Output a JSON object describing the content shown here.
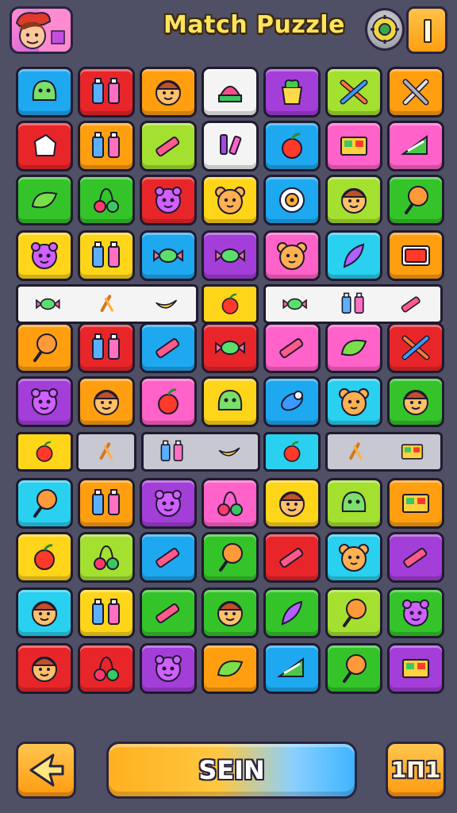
{
  "header": {
    "title": "Match Puzzle",
    "avatar_icon": "character-avatar-icon",
    "settings_icon": "gear-icon",
    "hint_icon": "hint-bar-icon"
  },
  "colors": {
    "background": "#4f4f66",
    "title": "#ffe45c",
    "orange": "#ff9f10",
    "red": "#e8262a",
    "blue": "#1ea8f0",
    "green": "#34c42a",
    "lime": "#a4e030",
    "yellow": "#ffd51a",
    "purple": "#a33ed8",
    "pink": "#ff62c8",
    "cyan": "#29d0f0",
    "white": "#f4f4f4"
  },
  "board": {
    "rows": [
      {
        "kind": "tiles",
        "tiles": [
          {
            "color": "blue",
            "icon": "slime-icon"
          },
          {
            "color": "red",
            "icon": "bottles-icon"
          },
          {
            "color": "orange",
            "icon": "face-icon"
          },
          {
            "color": "white",
            "icon": "cake-icon"
          },
          {
            "color": "purple",
            "icon": "potted-plant-icon"
          },
          {
            "color": "lime",
            "icon": "crossed-tools-icon"
          },
          {
            "color": "orange",
            "icon": "wrench-icon"
          }
        ]
      },
      {
        "kind": "tiles",
        "tiles": [
          {
            "color": "red",
            "icon": "sugar-cube-icon"
          },
          {
            "color": "orange",
            "icon": "bottle-pair-icon"
          },
          {
            "color": "lime",
            "icon": "crayon-icon"
          },
          {
            "color": "white",
            "icon": "markers-icon"
          },
          {
            "color": "blue",
            "icon": "cherry-icon"
          },
          {
            "color": "pink",
            "icon": "box-icon"
          },
          {
            "color": "pink",
            "icon": "candy-slice-icon"
          }
        ]
      },
      {
        "kind": "tiles",
        "tiles": [
          {
            "color": "green",
            "icon": "leaf-icon"
          },
          {
            "color": "green",
            "icon": "cherry-pair-icon"
          },
          {
            "color": "red",
            "icon": "monster-face-icon"
          },
          {
            "color": "yellow",
            "icon": "bear-face-icon"
          },
          {
            "color": "blue",
            "icon": "compass-icon"
          },
          {
            "color": "lime",
            "icon": "face-icon"
          },
          {
            "color": "green",
            "icon": "lollipop-icon"
          }
        ]
      },
      {
        "kind": "tiles",
        "tiles": [
          {
            "color": "yellow",
            "icon": "monster-face-icon"
          },
          {
            "color": "yellow",
            "icon": "bottle-pair-icon"
          },
          {
            "color": "blue",
            "icon": "candy-wrap-icon"
          },
          {
            "color": "purple",
            "icon": "candy-wrap-icon"
          },
          {
            "color": "pink",
            "icon": "bear-face-icon"
          },
          {
            "color": "cyan",
            "icon": "feather-icon"
          },
          {
            "color": "orange",
            "icon": "tv-icon"
          }
        ]
      },
      {
        "kind": "strip",
        "segments": [
          {
            "color": "white",
            "icons": [
              "candy-wrap-icon",
              "pretzel-icon",
              "banana-icon"
            ]
          },
          {
            "color": "yellow",
            "icons": [
              "berry-icon"
            ]
          },
          {
            "color": "white",
            "icons": [
              "candy-wrap-icon",
              "bottle-pair-icon",
              "crayon-icon"
            ]
          }
        ]
      },
      {
        "kind": "tiles",
        "tiles": [
          {
            "color": "orange",
            "icon": "lollipop-icon"
          },
          {
            "color": "red",
            "icon": "bottle-pair-icon"
          },
          {
            "color": "blue",
            "icon": "crayon-icon"
          },
          {
            "color": "red",
            "icon": "candy-wrap-icon"
          },
          {
            "color": "pink",
            "icon": "crayon-icon"
          },
          {
            "color": "pink",
            "icon": "leaf-icon"
          },
          {
            "color": "red",
            "icon": "crossed-tools-icon"
          }
        ]
      },
      {
        "kind": "tiles",
        "tiles": [
          {
            "color": "purple",
            "icon": "monster-face-icon"
          },
          {
            "color": "orange",
            "icon": "face-icon"
          },
          {
            "color": "pink",
            "icon": "berry-icon"
          },
          {
            "color": "yellow",
            "icon": "slime-icon"
          },
          {
            "color": "blue",
            "icon": "pacifier-icon"
          },
          {
            "color": "cyan",
            "icon": "bear-face-icon"
          },
          {
            "color": "green",
            "icon": "face-icon"
          }
        ]
      },
      {
        "kind": "strip",
        "segments": [
          {
            "color": "yellow",
            "icons": [
              "berry-icon"
            ]
          },
          {
            "color": "gray",
            "icons": [
              "pretzel-icon"
            ]
          },
          {
            "color": "gray",
            "icons": [
              "bottle-pair-icon",
              "banana-icon"
            ]
          },
          {
            "color": "cyan",
            "icons": [
              "cherry-icon"
            ]
          },
          {
            "color": "gray",
            "icons": [
              "pretzel-icon",
              "box-icon"
            ]
          }
        ]
      },
      {
        "kind": "tiles",
        "tiles": [
          {
            "color": "cyan",
            "icon": "lollipop-icon"
          },
          {
            "color": "orange",
            "icon": "bottle-pair-icon"
          },
          {
            "color": "purple",
            "icon": "monster-face-icon"
          },
          {
            "color": "pink",
            "icon": "cherry-pair-icon"
          },
          {
            "color": "yellow",
            "icon": "face-icon"
          },
          {
            "color": "lime",
            "icon": "slime-icon"
          },
          {
            "color": "orange",
            "icon": "box-icon"
          }
        ]
      },
      {
        "kind": "tiles",
        "tiles": [
          {
            "color": "yellow",
            "icon": "berry-icon"
          },
          {
            "color": "lime",
            "icon": "cherry-pair-icon"
          },
          {
            "color": "blue",
            "icon": "crayon-icon"
          },
          {
            "color": "green",
            "icon": "lollipop-icon"
          },
          {
            "color": "red",
            "icon": "crayon-icon"
          },
          {
            "color": "cyan",
            "icon": "bear-face-icon"
          },
          {
            "color": "purple",
            "icon": "crayon-icon"
          }
        ]
      },
      {
        "kind": "tiles",
        "tiles": [
          {
            "color": "cyan",
            "icon": "face-icon"
          },
          {
            "color": "yellow",
            "icon": "bottle-pair-icon"
          },
          {
            "color": "green",
            "icon": "crayon-icon"
          },
          {
            "color": "green",
            "icon": "face-icon"
          },
          {
            "color": "green",
            "icon": "feather-icon"
          },
          {
            "color": "lime",
            "icon": "lollipop-icon"
          },
          {
            "color": "green",
            "icon": "monster-face-icon"
          }
        ]
      },
      {
        "kind": "tiles",
        "tiles": [
          {
            "color": "red",
            "icon": "face-icon"
          },
          {
            "color": "red",
            "icon": "cherry-pair-icon"
          },
          {
            "color": "purple",
            "icon": "monster-face-icon"
          },
          {
            "color": "orange",
            "icon": "leaf-icon"
          },
          {
            "color": "blue",
            "icon": "candy-slice-icon"
          },
          {
            "color": "green",
            "icon": "lollipop-icon"
          },
          {
            "color": "purple",
            "icon": "box-icon"
          }
        ]
      }
    ]
  },
  "footer": {
    "back_icon": "arrow-left-icon",
    "main_label": "SEIN",
    "count_label": "1П1"
  }
}
